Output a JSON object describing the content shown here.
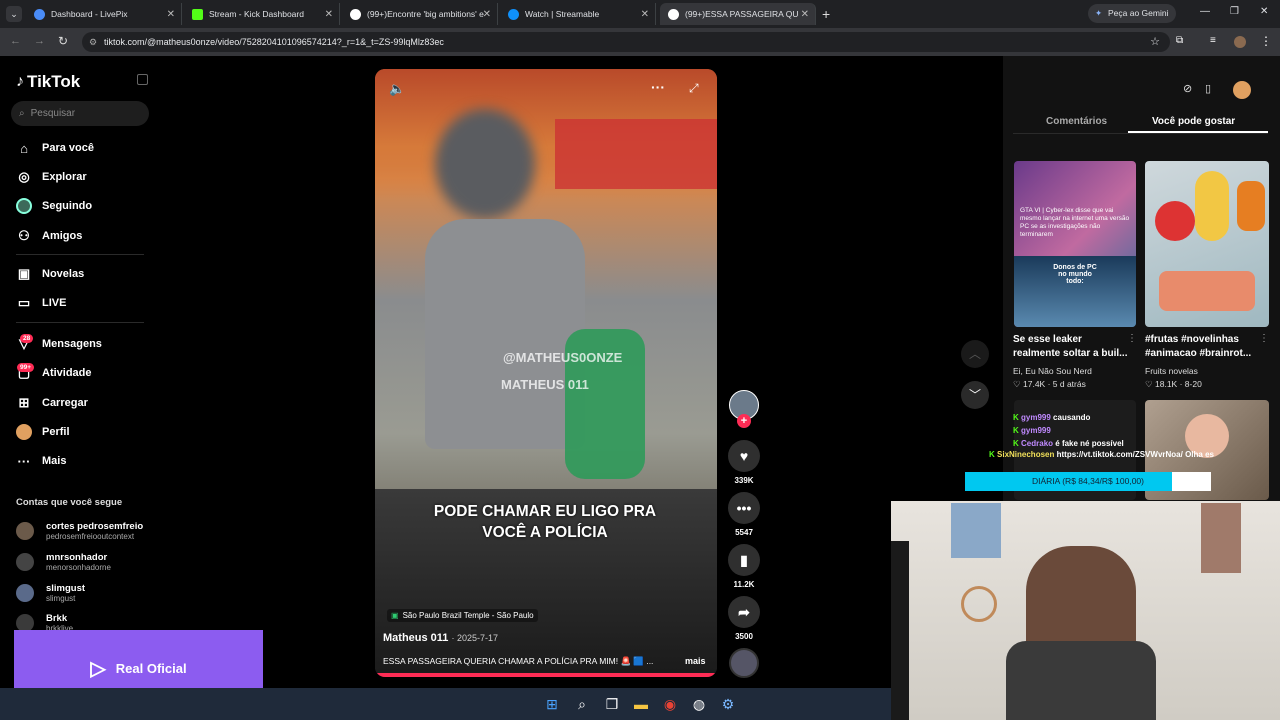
{
  "browser": {
    "tabs": [
      {
        "title": "Dashboard - LivePix",
        "color": "#4a8cf7"
      },
      {
        "title": "Stream - Kick Dashboard",
        "color": "#53fc18"
      },
      {
        "title": "(99+)Encontre 'big ambitions' e",
        "color": "#ffffff"
      },
      {
        "title": "Watch | Streamable",
        "color": "#0f90fa"
      },
      {
        "title": "(99+)ESSA PASSAGEIRA QU",
        "color": "#ffffff"
      }
    ],
    "gemini": "Peça ao Gemini",
    "url": "tiktok.com/@matheus0onze/video/7528204101096574214?_r=1&_t=ZS-99lqMlz83ec"
  },
  "sidebar": {
    "logo": "TikTok",
    "search_placeholder": "Pesquisar",
    "nav": [
      {
        "label": "Para você",
        "icon": "home-icon"
      },
      {
        "label": "Explorar",
        "icon": "compass-icon"
      },
      {
        "label": "Seguindo",
        "icon": "following-icon"
      },
      {
        "label": "Amigos",
        "icon": "friends-icon"
      },
      {
        "label": "Novelas",
        "icon": "novelas-icon"
      },
      {
        "label": "LIVE",
        "icon": "live-icon"
      },
      {
        "label": "Mensagens",
        "icon": "messages-icon"
      },
      {
        "label": "Atividade",
        "icon": "activity-icon"
      },
      {
        "label": "Carregar",
        "icon": "upload-icon"
      },
      {
        "label": "Perfil",
        "icon": "profile-icon"
      },
      {
        "label": "Mais",
        "icon": "more-icon"
      }
    ],
    "badges": {
      "messages": "28",
      "activity": "99+"
    },
    "following_title": "Contas que você segue",
    "following": [
      {
        "name": "cortes pedrosemfreio",
        "handle": "pedrosemfreiooutcontext"
      },
      {
        "name": "mnrsonhador",
        "handle": "menorsonhadorne"
      },
      {
        "name": "slimgust",
        "handle": "slimgust"
      },
      {
        "name": "Brkk",
        "handle": "brkklive"
      }
    ]
  },
  "video": {
    "watermark_handle": "@MATHEUS0ONZE",
    "watermark_name": "MATHEUS 011",
    "caption_overlay": "PODE CHAMAR EU LIGO PRA VOCÊ A POLÍCIA",
    "location": "São Paulo Brazil Temple - São Paulo",
    "author": "Matheus 011",
    "date": "· 2025-7-17",
    "description": "ESSA PASSAGEIRA QUERIA CHAMAR A POLÍCIA PRA MIM! 🚨 🟦 ...",
    "more": "mais",
    "likes": "339K",
    "comments": "5547",
    "saves": "11.2K",
    "shares": "3500"
  },
  "right_panel": {
    "tabs": [
      "Comentários",
      "Você pode gostar"
    ],
    "active_tab": "Você pode gostar",
    "cards": [
      {
        "title": "Se esse leaker realmente soltar a buil...",
        "author": "Ei, Eu Não Sou Nerd",
        "likes": "17.4K",
        "age": "5 d atrás",
        "thumb_text": "GTA VI | Cyber-lex disse que vai mesmo lançar na internet uma versão PC se as investigações não terminarem",
        "thumb_sub": "Donos de PC no mundo todo:"
      },
      {
        "title": "#frutas #novelinhas #animacao #brainrot...",
        "author": "Fruits novelas",
        "likes": "18.1K",
        "age": "8-20"
      }
    ]
  },
  "stream_overlay": {
    "chat": [
      {
        "user": "gym999",
        "msg": "causando"
      },
      {
        "user": "gym999",
        "msg": ""
      },
      {
        "user": "Cedrako",
        "msg": "é fake né possível"
      },
      {
        "user": "SixNinechosen",
        "msg": "https://vt.tiktok.com/ZSVWvrNoa/ Olha es"
      }
    ],
    "goal": "DIÁRIA (R$ 84,34/R$ 100,00)",
    "goal_fraction": 0.8434,
    "banner": "Real Oficial"
  }
}
